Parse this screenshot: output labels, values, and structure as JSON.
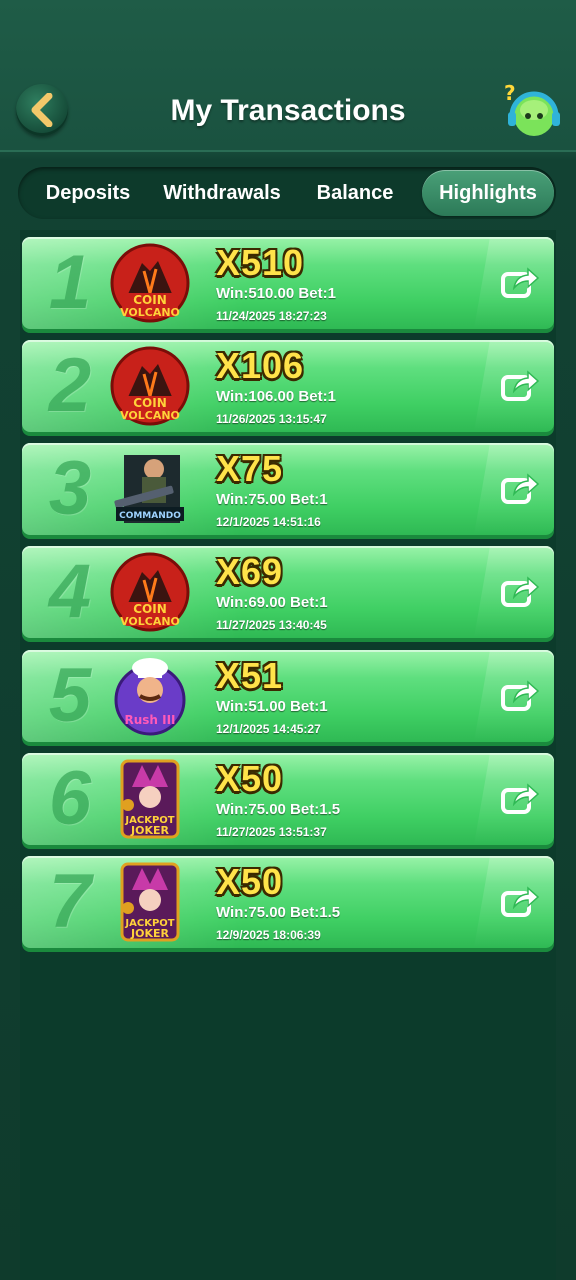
{
  "header": {
    "title": "My Transactions"
  },
  "tabs": [
    {
      "label": "Deposits",
      "active": false
    },
    {
      "label": "Withdrawals",
      "active": false
    },
    {
      "label": "Balance",
      "active": false
    },
    {
      "label": "Highlights",
      "active": true
    }
  ],
  "highlights": [
    {
      "rank": "1",
      "game_icon": "coin-volcano-icon",
      "multiplier": "X510",
      "win_bet": "Win:510.00 Bet:1",
      "date": "11/24/2025 18:27:23"
    },
    {
      "rank": "2",
      "game_icon": "coin-volcano-icon",
      "multiplier": "X106",
      "win_bet": "Win:106.00 Bet:1",
      "date": "11/26/2025 13:15:47"
    },
    {
      "rank": "3",
      "game_icon": "commando-game-icon",
      "multiplier": "X75",
      "win_bet": "Win:75.00 Bet:1",
      "date": "12/1/2025 14:51:16"
    },
    {
      "rank": "4",
      "game_icon": "coin-volcano-icon",
      "multiplier": "X69",
      "win_bet": "Win:69.00 Bet:1",
      "date": "11/27/2025 13:40:45"
    },
    {
      "rank": "5",
      "game_icon": "chef-game-icon",
      "multiplier": "X51",
      "win_bet": "Win:51.00 Bet:1",
      "date": "12/1/2025 14:45:27"
    },
    {
      "rank": "6",
      "game_icon": "jackpot-joker-icon",
      "multiplier": "X50",
      "win_bet": "Win:75.00 Bet:1.5",
      "date": "11/27/2025 13:51:37"
    },
    {
      "rank": "7",
      "game_icon": "jackpot-joker-icon",
      "multiplier": "X50",
      "win_bet": "Win:75.00 Bet:1.5",
      "date": "12/9/2025 18:06:39"
    }
  ],
  "colors": {
    "card_green": "#3fcf63",
    "multiplier_yellow": "#ffe34a",
    "bg_dark": "#0f3b2c"
  }
}
